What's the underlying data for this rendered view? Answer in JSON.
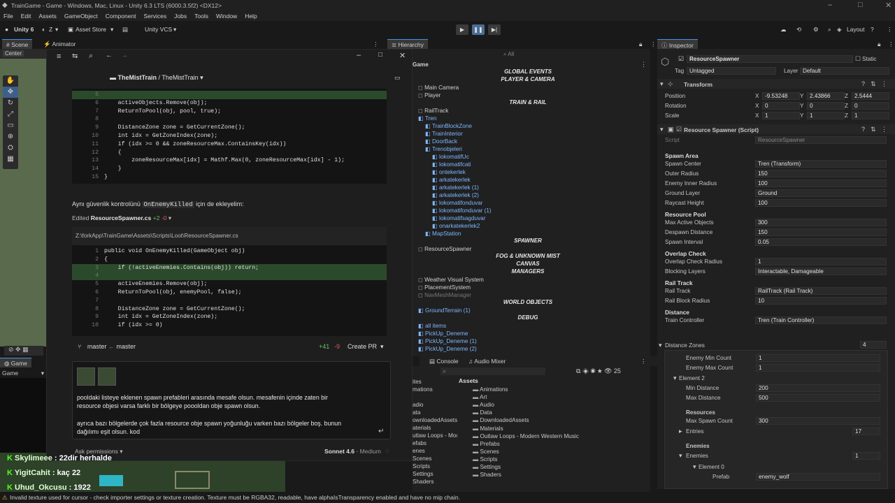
{
  "titlebar": {
    "title": "TrainGame - Game - Windows, Mac, Linux - Unity 6.3 LTS (6000.3.5f2) <DX12>"
  },
  "menu": [
    "File",
    "Edit",
    "Assets",
    "GameObject",
    "Component",
    "Services",
    "Jobs",
    "Tools",
    "Window",
    "Help"
  ],
  "toolbar": {
    "account": "Unity 6",
    "user": "Z",
    "store": "Asset Store",
    "vcs": "Unity VCS",
    "layout": "Layout"
  },
  "tabs": {
    "scene": "Scene",
    "animator": "Animator",
    "hierarchy": "Hierarchy",
    "inspector": "Inspector",
    "game": "Game",
    "console": "Console",
    "mixer": "Audio Mixer",
    "game_sub": "Game"
  },
  "scene": {
    "pivot": "Center"
  },
  "ide": {
    "breadcrumb_project": "TheMistTrain",
    "breadcrumb_sep": "/",
    "breadcrumb_sub": "TheMistTrain",
    "code1": [
      {
        "n": "5",
        "t": "",
        "add": true
      },
      {
        "n": "6",
        "t": "    activeObjects.Remove(obj);"
      },
      {
        "n": "7",
        "t": "    ReturnToPool(obj, pool, true);"
      },
      {
        "n": "8",
        "t": ""
      },
      {
        "n": "9",
        "t": "    DistanceZone zone = GetCurrentZone();"
      },
      {
        "n": "10",
        "t": "    int idx = GetZoneIndex(zone);"
      },
      {
        "n": "11",
        "t": "    if (idx >= 0 && zoneResourceMax.ContainsKey(idx))"
      },
      {
        "n": "12",
        "t": "    {"
      },
      {
        "n": "13",
        "t": "        zoneResourceMax[idx] = Mathf.Max(0, zoneResourceMax[idx] - 1);"
      },
      {
        "n": "14",
        "t": "    }"
      },
      {
        "n": "15",
        "t": "}"
      }
    ],
    "msg_text_a": "Aynı güvenlik kontrolünü ",
    "msg_code": "OnEnemyKilled",
    "msg_text_b": " için de ekleyelim:",
    "edited_label": "Edited",
    "edited_file": "ResourceSpawner.cs",
    "edited_plus": "+2",
    "edited_minus": "-0",
    "path": "Z:\\forkApp\\TrainGame\\Assets\\Scripts\\Loot\\ResourceSpawner.cs",
    "code2": [
      {
        "n": "1",
        "t": "public void OnEnemyKilled(GameObject obj)"
      },
      {
        "n": "2",
        "t": "{"
      },
      {
        "n": "3",
        "t": "    if (!activeEnemies.Contains(obj)) return;",
        "add": true
      },
      {
        "n": "4",
        "t": "",
        "add": true
      },
      {
        "n": "5",
        "t": "    activeEnemies.Remove(obj);"
      },
      {
        "n": "6",
        "t": "    ReturnToPool(obj, enemyPool, false);"
      },
      {
        "n": "7",
        "t": ""
      },
      {
        "n": "8",
        "t": "    DistanceZone zone = GetCurrentZone();"
      },
      {
        "n": "9",
        "t": "    int idx = GetZoneIndex(zone);"
      },
      {
        "n": "10",
        "t": "    if (idx >= 0)"
      }
    ],
    "branch_from": "master",
    "branch_arrow": "←",
    "branch_to": "master",
    "diff_plus": "+41",
    "diff_minus": "-9",
    "create_pr": "Create PR",
    "prompt_line1": "pooldaki listeye eklenen spawn prefableri arasında mesafe olsun. mesafenin içinde zaten bir",
    "prompt_line2": "resource objesi varsa farklı bir bölgeye poooldan obje spawn olsun.",
    "prompt_line3": "ayrıca bazı bölgelerde çok fazla resource obje spawn yoğunluğu varken bazı bölgeler boş. bunun",
    "prompt_line4": "dağılımı eşit olsun. kod",
    "ask": "Ask permissions",
    "model": "Sonnet 4.6",
    "effort": "Medium"
  },
  "hierarchy": {
    "search": "All",
    "root": "Game",
    "rows": [
      {
        "k": "sec",
        "t": "GLOBAL EVENTS"
      },
      {
        "k": "sec",
        "t": "PLAYER & CAMERA"
      },
      {
        "k": "obj",
        "t": "Main Camera",
        "d": 0
      },
      {
        "k": "obj",
        "t": "Player",
        "d": 0
      },
      {
        "k": "sec",
        "t": "TRAIN & RAIL"
      },
      {
        "k": "obj",
        "t": "RailTrack",
        "d": 0
      },
      {
        "k": "blue",
        "t": "Tren",
        "d": 0
      },
      {
        "k": "blue",
        "t": "TrainBlockZone",
        "d": 1
      },
      {
        "k": "blue",
        "t": "TrainInterior",
        "d": 1
      },
      {
        "k": "blue",
        "t": "DoorBack",
        "d": 1
      },
      {
        "k": "blue",
        "t": "Trenobjeleri",
        "d": 1
      },
      {
        "k": "blue",
        "t": "lokomatifUc",
        "d": 2
      },
      {
        "k": "blue",
        "t": "lokomatifcati",
        "d": 2
      },
      {
        "k": "blue",
        "t": "ontekerlek",
        "d": 2
      },
      {
        "k": "blue",
        "t": "arkatekerlek",
        "d": 2
      },
      {
        "k": "blue",
        "t": "arkatekerlek (1)",
        "d": 2
      },
      {
        "k": "blue",
        "t": "arkatekerlek (2)",
        "d": 2
      },
      {
        "k": "blue",
        "t": "lokomatifonduvar",
        "d": 2
      },
      {
        "k": "blue",
        "t": "lokomatifonduvar (1)",
        "d": 2
      },
      {
        "k": "blue",
        "t": "lokomatifsagduvar",
        "d": 2
      },
      {
        "k": "blue",
        "t": "onarkatekerlek2",
        "d": 2
      },
      {
        "k": "blue",
        "t": "MapStation",
        "d": 1
      },
      {
        "k": "sec",
        "t": "SPAWNER"
      },
      {
        "k": "obj",
        "t": "ResourceSpawner",
        "d": 0
      },
      {
        "k": "sec",
        "t": "FOG & UNKNOWN MIST"
      },
      {
        "k": "sec",
        "t": "CANVAS"
      },
      {
        "k": "sec",
        "t": "MANAGERS"
      },
      {
        "k": "obj",
        "t": "Weather Visual System",
        "d": 0
      },
      {
        "k": "obj",
        "t": "PlacementSystem",
        "d": 0
      },
      {
        "k": "dim",
        "t": "NavMeshManager",
        "d": 0
      },
      {
        "k": "sec",
        "t": "WORLD OBJECTS"
      },
      {
        "k": "blue",
        "t": "GroundTerrain (1)",
        "d": 0
      },
      {
        "k": "sec",
        "t": "DEBUG"
      },
      {
        "k": "blue",
        "t": "all items",
        "d": 0
      },
      {
        "k": "blue",
        "t": "PickUp_Deneme",
        "d": 0
      },
      {
        "k": "blue",
        "t": "PickUp_Deneme (1)",
        "d": 0
      },
      {
        "k": "blue",
        "t": "PickUp_Deneme (2)",
        "d": 0
      }
    ]
  },
  "project": {
    "badge": "25",
    "assets_label": "Assets",
    "left": [
      "ites",
      "mations",
      "",
      "adio",
      "ata",
      "ownloadedAssets",
      "aterials",
      "utlaw Loops - Moc",
      "efabs",
      "enes",
      "Scenes",
      "Scripts",
      "Settings",
      "Shaders"
    ],
    "folders": [
      "Animations",
      "Art",
      "Audio",
      "Data",
      "DownloadedAssets",
      "Materials",
      "Outlaw Loops - Modern Western Music",
      "Prefabs",
      "Scenes",
      "Scripts",
      "Settings",
      "Shaders"
    ]
  },
  "inspector": {
    "object_name": "ResourceSpawner",
    "static": "Static",
    "tag_label": "Tag",
    "tag": "Untagged",
    "layer_label": "Layer",
    "layer": "Default",
    "transform": "Transform",
    "position": {
      "label": "Position",
      "x": "-9.53248",
      "y": "2.43866",
      "z": "2.5444"
    },
    "rotation": {
      "label": "Rotation",
      "x": "0",
      "y": "0",
      "z": "0"
    },
    "scale": {
      "label": "Scale",
      "x": "1",
      "y": "1",
      "z": "1"
    },
    "component": "Resource Spawner (Script)",
    "script_label": "Script",
    "script": "ResourceSpawner",
    "rows": [
      {
        "h": "Spawn Area"
      },
      {
        "l": "Spawn Center",
        "v": "Tren (Transform)"
      },
      {
        "l": "Outer Radius",
        "v": "150"
      },
      {
        "l": "Enemy Inner Radius",
        "v": "100"
      },
      {
        "l": "Ground Layer",
        "v": "Ground"
      },
      {
        "l": "Raycast Height",
        "v": "100"
      },
      {
        "h": "Resource Pool"
      },
      {
        "l": "Max Active Objects",
        "v": "300"
      },
      {
        "l": "Despawn Distance",
        "v": "150"
      },
      {
        "l": "Spawn Interval",
        "v": "0.05"
      },
      {
        "h": "Overlap Check"
      },
      {
        "l": "Overlap Check Radius",
        "v": "1"
      },
      {
        "l": "Blocking Layers",
        "v": "Interactable, Damageable"
      },
      {
        "h": "Rail Track"
      },
      {
        "l": "Rail Track",
        "v": "RailTrack (Rail Track)"
      },
      {
        "l": "Rail Block Radius",
        "v": "10"
      },
      {
        "h": "Distance"
      },
      {
        "l": "Train Controller",
        "v": "Tren (Train Controller)"
      }
    ],
    "zones_label": "Distance Zones",
    "zones_count": "4",
    "enemy_min": {
      "l": "Enemy Min Count",
      "v": "1"
    },
    "enemy_max": {
      "l": "Enemy Max Count",
      "v": "1"
    },
    "element2": "Element 2",
    "min_dist": {
      "l": "Min Distance",
      "v": "200"
    },
    "max_dist": {
      "l": "Max Distance",
      "v": "500"
    },
    "resources_h": "Resources",
    "max_spawn": {
      "l": "Max Spawn Count",
      "v": "300"
    },
    "entries_label": "Entries",
    "entries_count": "17",
    "enemies_h": "Enemies",
    "enemies_label": "Enemies",
    "enemies_count": "1",
    "element0": "Element 0",
    "prefab_label": "Prefab",
    "prefab": "enemy_wolf"
  },
  "chat": [
    {
      "user": "Skylimeee",
      "msg": ": 22dir herhalde"
    },
    {
      "user": "YigitCahit",
      "msg": ": kaç 22"
    },
    {
      "user": "Uhud_Okcusu",
      "msg": ": 1922"
    }
  ],
  "status": "Invalid texture used for cursor - check importer settings or texture creation. Texture must be RGBA32, readable, have alphaIsTransparency enabled and have no mip chain."
}
